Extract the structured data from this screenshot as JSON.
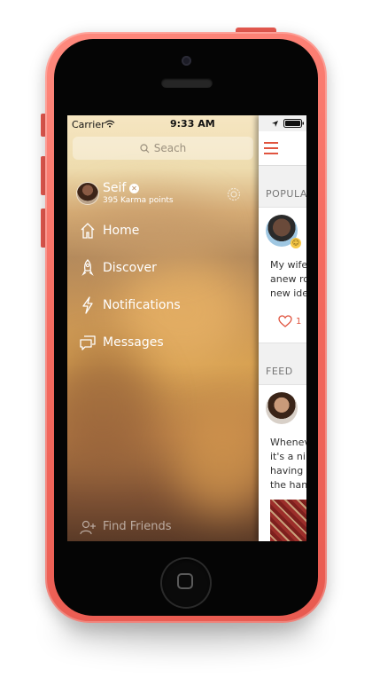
{
  "status_bar": {
    "carrier": "Carrier",
    "time": "9:33 AM"
  },
  "search": {
    "placeholder": "Seach"
  },
  "profile": {
    "name": "Seif",
    "karma": "395 Karma points"
  },
  "nav": [
    {
      "label": "Home",
      "icon": "home-icon"
    },
    {
      "label": "Discover",
      "icon": "rocket-icon"
    },
    {
      "label": "Notifications",
      "icon": "lightning-icon"
    },
    {
      "label": "Messages",
      "icon": "chat-icon"
    }
  ],
  "find_friends": {
    "label": "Find Friends",
    "icon": "add-user-icon"
  },
  "feed": {
    "popular_label": "POPULA",
    "post_lines": [
      "My wife",
      "anew ro",
      "new ide"
    ],
    "like_count": "1",
    "feed_label": "FEED",
    "feed_lines": [
      "Whenev",
      "it's a ni",
      "having a",
      "the hand"
    ]
  },
  "colors": {
    "accent": "#e0543f",
    "phone_body": "#f46a5f"
  }
}
